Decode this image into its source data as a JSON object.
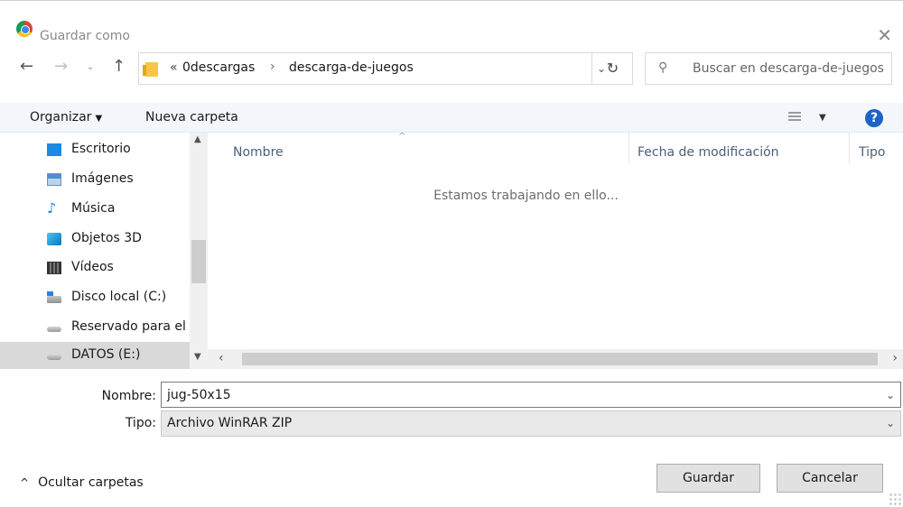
{
  "window": {
    "title": "Guardar como",
    "close_glyph": "✕"
  },
  "nav_buttons": {
    "back": "←",
    "forward": "→",
    "recent": "⌄",
    "up": "↑"
  },
  "address": {
    "overflow_glyph": "«",
    "crumbs": [
      "0descargas",
      "descarga-de-juegos"
    ],
    "separator": "›",
    "dropdown_glyph": "⌄",
    "refresh_glyph": "↻"
  },
  "search": {
    "placeholder": "Buscar en descarga-de-juegos",
    "icon_glyph": "⚲"
  },
  "toolbar": {
    "organize_label": "Organizar",
    "new_folder_label": "Nueva carpeta",
    "help_glyph": "?"
  },
  "sidebar": {
    "items": [
      {
        "label": "Escritorio",
        "icon": "desktop-icon"
      },
      {
        "label": "Imágenes",
        "icon": "images-icon"
      },
      {
        "label": "Música",
        "icon": "music-icon"
      },
      {
        "label": "Objetos 3D",
        "icon": "objects-3d-icon"
      },
      {
        "label": "Vídeos",
        "icon": "videos-icon"
      },
      {
        "label": "Disco local (C:)",
        "icon": "local-disk-icon"
      },
      {
        "label": "Reservado para el",
        "icon": "drive-icon"
      },
      {
        "label": "DATOS (E:)",
        "icon": "drive-icon",
        "selected": true
      }
    ]
  },
  "file_list": {
    "columns": [
      "Nombre",
      "Fecha de modificación",
      "Tipo"
    ],
    "empty_message": "Estamos trabajando en ello..."
  },
  "form": {
    "name_label": "Nombre:",
    "name_value": "jug-50x15",
    "type_label": "Tipo:",
    "type_value": "Archivo WinRAR ZIP"
  },
  "footer": {
    "hide_folders_label": "Ocultar carpetas",
    "save_label": "Guardar",
    "cancel_label": "Cancelar"
  }
}
